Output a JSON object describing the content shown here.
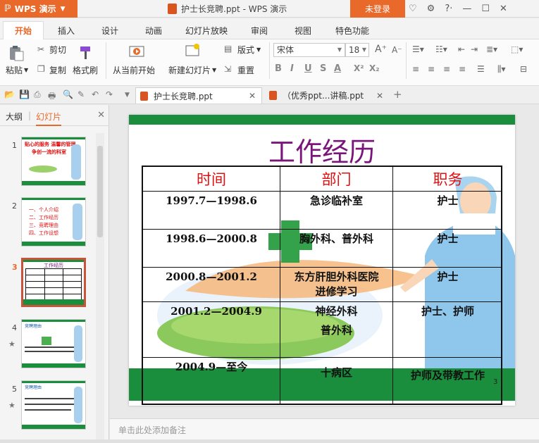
{
  "app": {
    "name": "WPS 演示",
    "window_title": "护士长竞聘.ppt - WPS 演示",
    "login_label": "未登录",
    "colors": {
      "brand": "#e8692a",
      "slide_green": "#1a8e3c",
      "title_purple": "#7a167a",
      "header_red": "#e01010"
    }
  },
  "menu": {
    "tabs": [
      "开始",
      "插入",
      "设计",
      "动画",
      "幻灯片放映",
      "审阅",
      "视图",
      "特色功能"
    ],
    "active": "开始"
  },
  "ribbon": {
    "paste": "粘贴",
    "cut": "剪切",
    "copy": "复制",
    "format_painter": "格式刷",
    "from_current": "从当前开始",
    "new_slide": "新建幻灯片",
    "layout": "版式",
    "reset": "重置",
    "font_name": "宋体",
    "font_size": "18",
    "bold": "B",
    "italic": "I",
    "underline": "U",
    "strike": "S",
    "font_color": "A",
    "superscript": "X²",
    "subscript": "X₂"
  },
  "doc_tabs": [
    {
      "label": "护士长竞聘.ppt",
      "active": true
    },
    {
      "label": "（优秀ppt...讲稿.ppt",
      "active": false
    }
  ],
  "left_panel": {
    "tab_outline": "大纲",
    "tab_slides": "幻灯片",
    "thumbnails": [
      {
        "num": "1",
        "starred": false,
        "line1": "贴心的服务  温馨的管理",
        "line2": "争创一流的科室"
      },
      {
        "num": "2",
        "starred": false,
        "items": [
          "一、个人介绍",
          "二、工作经历",
          "三、竞聘理由",
          "四、工作设想"
        ]
      },
      {
        "num": "3",
        "starred": false,
        "selected": true,
        "title": "工作经历"
      },
      {
        "num": "4",
        "starred": true,
        "title": "竞聘理由"
      },
      {
        "num": "5",
        "starred": true,
        "title": "竞聘理由"
      }
    ]
  },
  "slide": {
    "title": "工作经历",
    "page_number": "3",
    "headers": [
      "时间",
      "部门",
      "职务"
    ],
    "rows": [
      {
        "time": "1997.7—1998.6",
        "dept": "急诊临补室",
        "role": "护士"
      },
      {
        "time": "1998.6—2000.8",
        "dept": "胸外科、普外科",
        "role": "护士"
      },
      {
        "time": "2000.8—2001.2",
        "dept": "东方肝胆外科医院",
        "dept2": "进修学习",
        "role": "护士"
      },
      {
        "time": "2001.2—2004.9",
        "dept": "神经外科",
        "dept2": "普外科",
        "role": "护士、护师"
      },
      {
        "time": "2004.9—至今",
        "dept": "十病区",
        "role": "护师及带教工作"
      }
    ]
  },
  "notes_placeholder": "单击此处添加备注"
}
